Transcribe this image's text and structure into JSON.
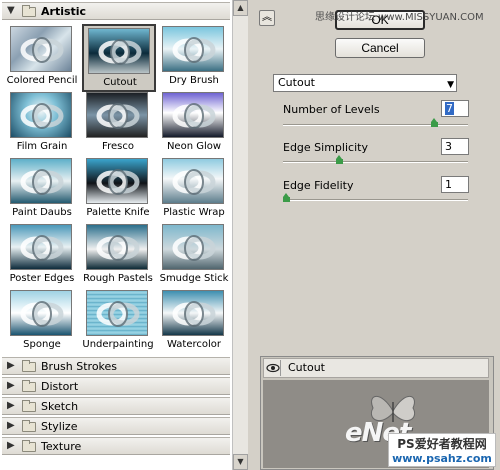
{
  "watermark": "思缘设计论坛 www.MISSYUAN.COM",
  "left_panel": {
    "categories": {
      "artistic": "Artistic",
      "brush_strokes": "Brush Strokes",
      "distort": "Distort",
      "sketch": "Sketch",
      "stylize": "Stylize",
      "texture": "Texture"
    },
    "thumbnails": [
      {
        "label": "Colored Pencil",
        "selected": false
      },
      {
        "label": "Cutout",
        "selected": true
      },
      {
        "label": "Dry Brush",
        "selected": false
      },
      {
        "label": "Film Grain",
        "selected": false
      },
      {
        "label": "Fresco",
        "selected": false
      },
      {
        "label": "Neon Glow",
        "selected": false
      },
      {
        "label": "Paint Daubs",
        "selected": false
      },
      {
        "label": "Palette Knife",
        "selected": false
      },
      {
        "label": "Plastic Wrap",
        "selected": false
      },
      {
        "label": "Poster Edges",
        "selected": false
      },
      {
        "label": "Rough Pastels",
        "selected": false
      },
      {
        "label": "Smudge Stick",
        "selected": false
      },
      {
        "label": "Sponge",
        "selected": false
      },
      {
        "label": "Underpainting",
        "selected": false
      },
      {
        "label": "Watercolor",
        "selected": false
      }
    ]
  },
  "buttons": {
    "ok": "OK",
    "cancel": "Cancel"
  },
  "settings": {
    "filter_selected": "Cutout",
    "params": [
      {
        "label": "Number of Levels",
        "value": "7",
        "min": 2,
        "max": 8
      },
      {
        "label": "Edge Simplicity",
        "value": "3",
        "min": 0,
        "max": 10
      },
      {
        "label": "Edge Fidelity",
        "value": "1",
        "min": 1,
        "max": 3
      }
    ]
  },
  "effect_layer": {
    "label": "Cutout"
  },
  "branding": {
    "logo": "eNet",
    "tag_line1": "PS爱好者教程网",
    "tag_line2": "www.psahz.com"
  },
  "colors": {
    "slider_thumb": "#3b9b48",
    "selection_highlight": "#316ac5"
  }
}
